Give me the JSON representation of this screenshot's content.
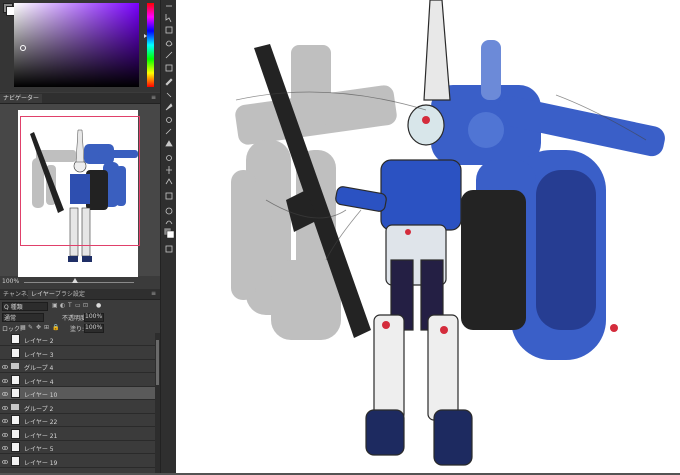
{
  "navigator": {
    "tab_label": "ナビゲーター",
    "zoom": "100%"
  },
  "layers_panel": {
    "tabs": [
      {
        "label": "チャンネル"
      },
      {
        "label": "レイヤー"
      },
      {
        "label": "ブラシ設定"
      }
    ],
    "filter_label": "Q 種類",
    "blend_mode": "通常",
    "opacity_label": "不透明度:",
    "opacity_value": "100%",
    "lock_label": "ロック:",
    "fill_label": "塗り:",
    "fill_value": "100%",
    "layers": [
      {
        "name": "レイヤー 2",
        "type": "layer",
        "visible": false,
        "selected": false
      },
      {
        "name": "レイヤー 3",
        "type": "layer",
        "visible": false,
        "selected": false
      },
      {
        "name": "グループ 4",
        "type": "group",
        "visible": true,
        "selected": false
      },
      {
        "name": "レイヤー 4",
        "type": "layer",
        "visible": true,
        "selected": false
      },
      {
        "name": "レイヤー 10",
        "type": "layer",
        "visible": true,
        "selected": true
      },
      {
        "name": "グループ 2",
        "type": "group",
        "visible": true,
        "selected": false
      },
      {
        "name": "レイヤー 22",
        "type": "layer",
        "visible": true,
        "selected": false
      },
      {
        "name": "レイヤー 21",
        "type": "layer",
        "visible": true,
        "selected": false
      },
      {
        "name": "レイヤー 5",
        "type": "layer",
        "visible": true,
        "selected": false
      },
      {
        "name": "レイヤー 19",
        "type": "layer",
        "visible": true,
        "selected": false
      }
    ]
  },
  "colors": {
    "accent_magenta": "#e0406a",
    "picker_hue": "#7a00ff"
  }
}
